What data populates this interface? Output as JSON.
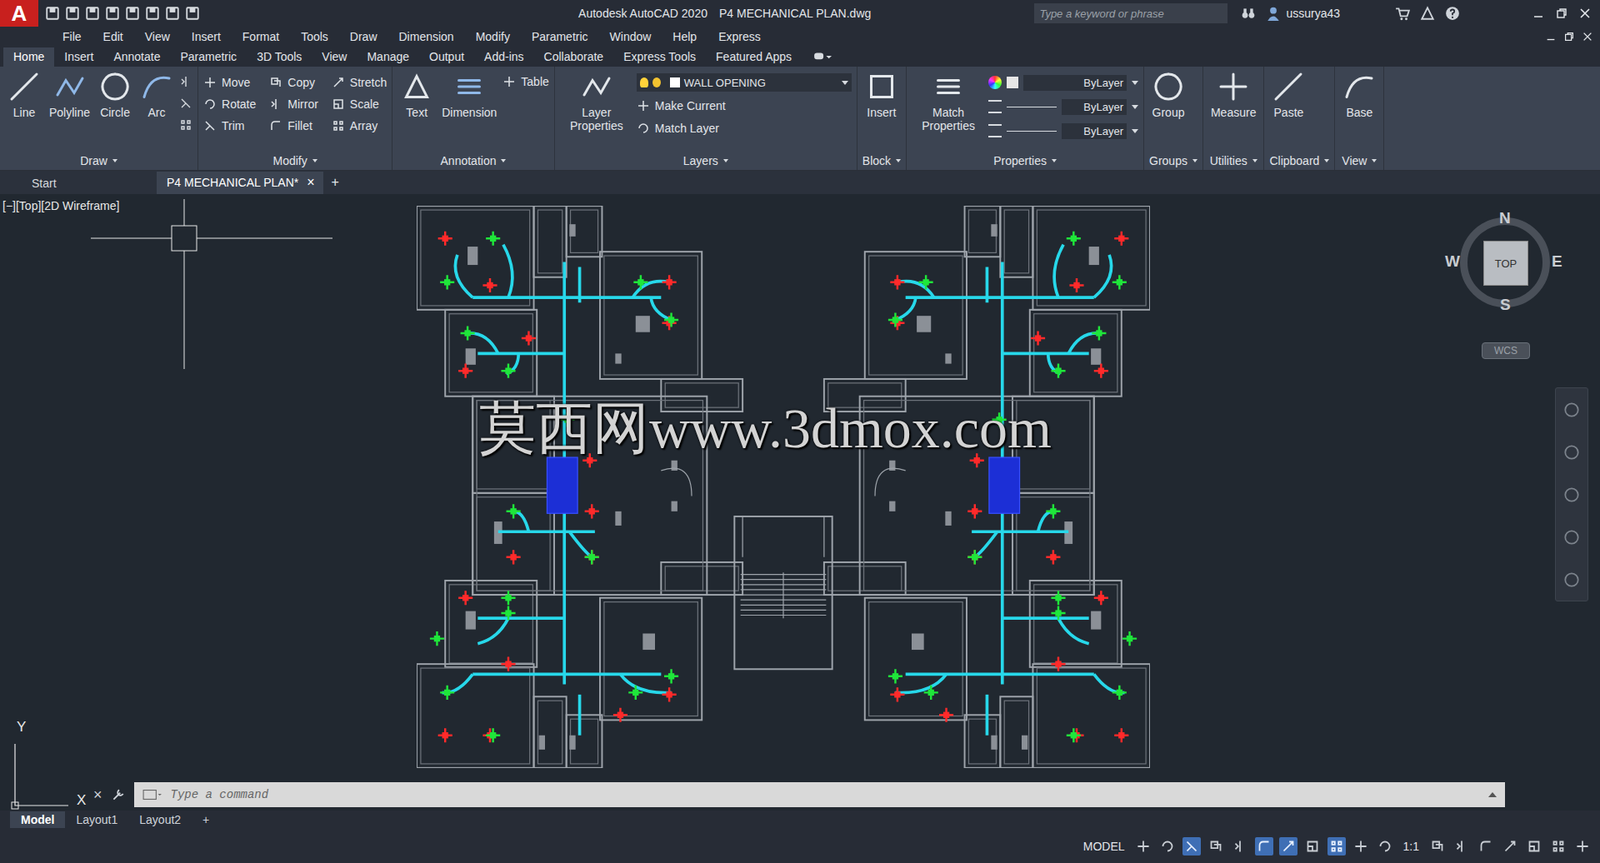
{
  "window": {
    "logo": "A",
    "app": "Autodesk AutoCAD 2020",
    "document": "P4 MECHANICAL PLAN.dwg"
  },
  "search": {
    "placeholder": "Type a keyword or phrase"
  },
  "user": {
    "name": "ussurya43"
  },
  "menu": [
    "File",
    "Edit",
    "View",
    "Insert",
    "Format",
    "Tools",
    "Draw",
    "Dimension",
    "Modify",
    "Parametric",
    "Window",
    "Help",
    "Express"
  ],
  "ribbon_tabs": [
    {
      "label": "Home",
      "selected": true
    },
    {
      "label": "Insert",
      "selected": false
    },
    {
      "label": "Annotate",
      "selected": false
    },
    {
      "label": "Parametric",
      "selected": false
    },
    {
      "label": "3D Tools",
      "selected": false
    },
    {
      "label": "View",
      "selected": false
    },
    {
      "label": "Manage",
      "selected": false
    },
    {
      "label": "Output",
      "selected": false
    },
    {
      "label": "Add-ins",
      "selected": false
    },
    {
      "label": "Collaborate",
      "selected": false
    },
    {
      "label": "Express Tools",
      "selected": false
    },
    {
      "label": "Featured Apps",
      "selected": false
    }
  ],
  "ribbon_panels": [
    {
      "title": "Draw",
      "large": [
        "Line",
        "Polyline",
        "Circle",
        "Arc"
      ],
      "small": []
    },
    {
      "title": "Modify",
      "large": [],
      "small": [
        "Move",
        "Rotate",
        "Trim",
        "Copy",
        "Mirror",
        "Fillet",
        "Stretch",
        "Scale",
        "Array"
      ]
    },
    {
      "title": "Annotation",
      "large": [
        "Text",
        "Dimension"
      ],
      "small": [
        "Table"
      ]
    },
    {
      "title": "Layers",
      "large": [
        "Layer Properties"
      ],
      "dropdown": "WALL OPENING",
      "small": [
        "Make Current",
        "Match Layer"
      ]
    },
    {
      "title": "Block",
      "large": [
        "Insert"
      ],
      "small": []
    },
    {
      "title": "Properties",
      "large": [
        "Match Properties"
      ],
      "fields": [
        "ByLayer",
        "ByLayer",
        "ByLayer"
      ],
      "small": []
    },
    {
      "title": "Groups",
      "large": [
        "Group"
      ],
      "small": []
    },
    {
      "title": "Utilities",
      "large": [
        "Measure"
      ],
      "small": []
    },
    {
      "title": "Clipboard",
      "large": [
        "Paste"
      ],
      "small": []
    },
    {
      "title": "View",
      "large": [
        "Base"
      ],
      "small": []
    }
  ],
  "file_tabs": [
    {
      "label": "Start",
      "selected": false,
      "close": ""
    },
    {
      "label": "P4 MECHANICAL PLAN*",
      "selected": true,
      "close": "×"
    }
  ],
  "new_tab": "+",
  "viewport_label": "[−][Top][2D Wireframe]",
  "watermark": "莫西网www.3dmox.com",
  "viewcube": {
    "n": "N",
    "s": "S",
    "e": "E",
    "w": "W",
    "face": "TOP",
    "ucs": "WCS"
  },
  "ucs_axes": {
    "x": "X",
    "y": "Y"
  },
  "command_line": {
    "close": "×",
    "placeholder": "Type a command"
  },
  "layout_tabs": [
    {
      "label": "Model",
      "selected": true
    },
    {
      "label": "Layout1",
      "selected": false
    },
    {
      "label": "Layout2",
      "selected": false
    }
  ],
  "new_layout": "+",
  "status_bar": {
    "mode": "MODEL",
    "scale": "1:1"
  },
  "status_toggles": [
    {
      "on": false
    },
    {
      "on": false
    },
    {
      "on": true
    },
    {
      "on": false
    },
    {
      "on": false
    },
    {
      "on": true
    },
    {
      "on": true
    },
    {
      "on": false
    },
    {
      "on": true
    },
    {
      "on": false
    },
    {
      "on": false
    }
  ]
}
